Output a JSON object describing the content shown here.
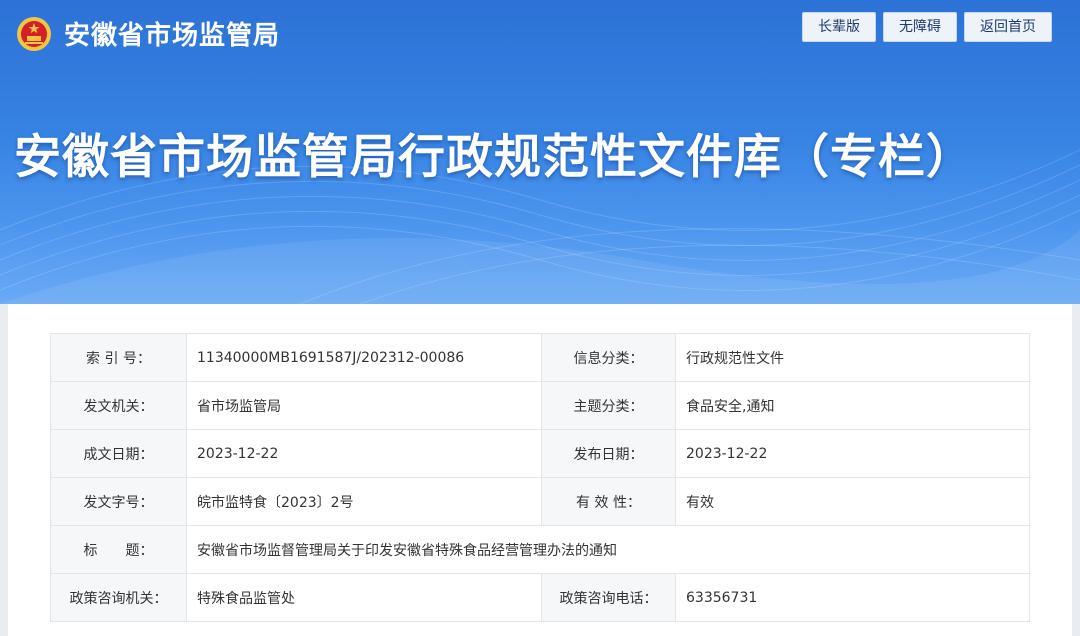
{
  "header": {
    "site_name": "安徽省市场监管局",
    "buttons": [
      "长辈版",
      "无障碍",
      "返回首页"
    ],
    "banner_title": "安徽省市场监管局行政规范性文件库（专栏）"
  },
  "info_table": {
    "rows": [
      {
        "label1": "索 引 号：",
        "value1": "11340000MB1691587J/202312-00086",
        "label2": "信息分类：",
        "value2": "行政规范性文件"
      },
      {
        "label1": "发文机关：",
        "value1": "省市场监管局",
        "label2": "主题分类：",
        "value2": "食品安全,通知"
      },
      {
        "label1": "成文日期：",
        "value1": "2023-12-22",
        "label2": "发布日期：",
        "value2": "2023-12-22"
      },
      {
        "label1": "发文字号：",
        "value1": "皖市监特食〔2023〕2号",
        "label2": "有 效 性：",
        "value2": "有效"
      }
    ],
    "title_row": {
      "label": "标　　题：",
      "value": "安徽省市场监督管理局关于印发安徽省特殊食品经营管理办法的通知"
    },
    "contact_row": {
      "label1": "政策咨询机关：",
      "value1": "特殊食品监管处",
      "label2": "政策咨询电话：",
      "value2": "63356731"
    }
  },
  "colors": {
    "banner": "#3683e3",
    "label_bg": "#f6f7f9",
    "emblem_red": "#d3202a",
    "emblem_gold": "#f4c542"
  }
}
